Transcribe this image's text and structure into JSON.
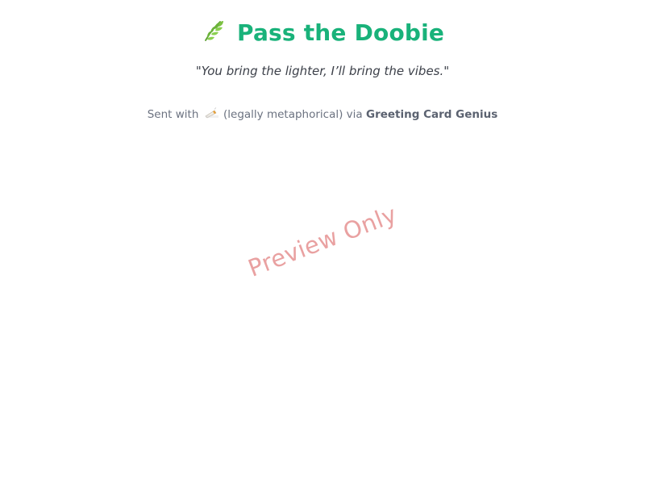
{
  "card": {
    "icon": "herb-leaf-icon",
    "title": "Pass the Doobie",
    "tagline": "\"You bring the lighter, I’ll bring the vibes.\""
  },
  "footer": {
    "prefix": "Sent with",
    "icon": "joint-icon",
    "suffix": "(legally metaphorical) via",
    "brand": "Greeting Card Genius"
  },
  "watermark": {
    "text": "Preview Only",
    "color": "#e28282"
  },
  "colors": {
    "title": "#19b27a",
    "tagline": "#3c4049",
    "footer": "#6b7280",
    "background": "#ffffff"
  }
}
